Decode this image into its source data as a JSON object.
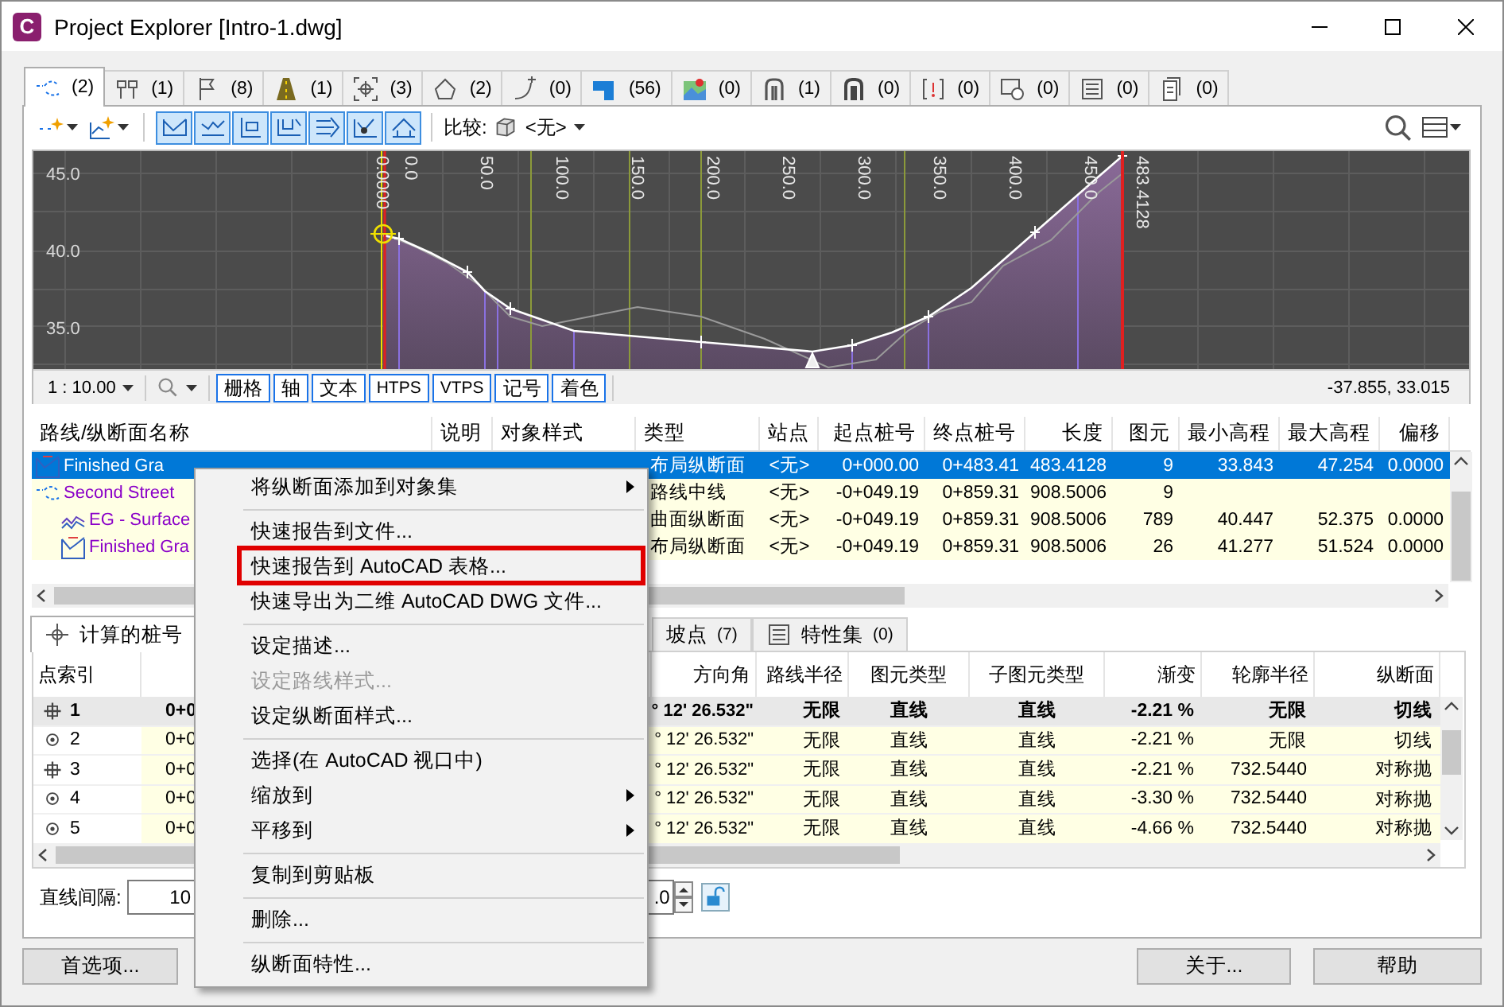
{
  "window": {
    "title": "Project Explorer [Intro-1.dwg]",
    "logo": "C"
  },
  "object_tabs": [
    {
      "count": "(2)",
      "selected": true
    },
    {
      "count": "(1)",
      "selected": false
    },
    {
      "count": "(8)",
      "selected": false
    },
    {
      "count": "(1)",
      "selected": false
    },
    {
      "count": "(3)",
      "selected": false
    },
    {
      "count": "(2)",
      "selected": false
    },
    {
      "count": "(0)",
      "selected": false
    },
    {
      "count": "(56)",
      "selected": false
    },
    {
      "count": "(0)",
      "selected": false
    },
    {
      "count": "(1)",
      "selected": false
    },
    {
      "count": "(0)",
      "selected": false
    },
    {
      "count": "(0)",
      "selected": false
    },
    {
      "count": "(0)",
      "selected": false
    },
    {
      "count": "(0)",
      "selected": false
    },
    {
      "count": "(0)",
      "selected": false
    }
  ],
  "toolbar": {
    "view_buttons": [
      {
        "on": true
      },
      {
        "on": true
      },
      {
        "on": true
      },
      {
        "on": true
      },
      {
        "on": true
      },
      {
        "on": true
      },
      {
        "on": true
      }
    ],
    "compare_label": "比较:",
    "compare_value": "<无>"
  },
  "profile_view": {
    "elevation_labels": [
      "45.0",
      "40.0",
      "35.0"
    ],
    "station_labels": [
      "0.0000",
      "0.0",
      "50.0",
      "100.0",
      "150.0",
      "200.0",
      "250.0",
      "300.0",
      "350.0",
      "400.0",
      "450.0",
      "483.4128"
    ],
    "scale": "1 : 10.00",
    "toggles": [
      {
        "label": "栅格",
        "on": true
      },
      {
        "label": "轴",
        "on": true
      },
      {
        "label": "文本",
        "on": true
      },
      {
        "label": "HTPS",
        "on": true
      },
      {
        "label": "VTPS",
        "on": true
      },
      {
        "label": "记号",
        "on": true
      },
      {
        "label": "着色",
        "on": true
      }
    ],
    "coordinates": "-37.855, 33.015"
  },
  "profile_list": {
    "columns": [
      "路线/纵断面名称",
      "说明",
      "对象样式",
      "类型",
      "站点",
      "起点桩号",
      "终点桩号",
      "长度",
      "图元",
      "最小高程",
      "最大高程",
      "偏移"
    ],
    "rows": [
      {
        "kind": "layout_profile",
        "selected": true,
        "cells": [
          "Finished Gra",
          null,
          null,
          "布局纵断面",
          "<无>",
          "0+000.00",
          "0+483.41",
          "483.4128",
          "9",
          "33.843",
          "47.254",
          "0.0000"
        ]
      },
      {
        "kind": "alignment",
        "selected": false,
        "cells": [
          "Second Street",
          null,
          null,
          "路线中线",
          "<无>",
          "-0+049.19",
          "0+859.31",
          "908.5006",
          "9",
          null,
          null,
          null
        ],
        "children": [
          {
            "kind": "surface_profile",
            "selected": false,
            "cells": [
              "EG - Surface",
              null,
              null,
              "曲面纵断面",
              "<无>",
              "-0+049.19",
              "0+859.31",
              "908.5006",
              "789",
              "40.447",
              "52.375",
              "0.0000"
            ]
          },
          {
            "kind": "layout_profile",
            "selected": false,
            "cells": [
              "Finished Gra",
              null,
              null,
              "布局纵断面",
              "<无>",
              "-0+049.19",
              "0+859.31",
              "908.5006",
              "26",
              "41.277",
              "51.524",
              "0.0000"
            ]
          }
        ]
      }
    ]
  },
  "detail_tabs": [
    {
      "label": "计算的桩号",
      "selected": true
    },
    {
      "label": "坡点",
      "count": "(7)",
      "selected": false
    },
    {
      "label": "特性集",
      "count": "(0)",
      "selected": false
    }
  ],
  "detail_table": {
    "columns": [
      "点索引",
      null,
      "方向角",
      "路线半径",
      "图元类型",
      "子图元类型",
      "渐变",
      "轮廓半径",
      "纵断面"
    ],
    "rows": [
      {
        "kind": "pvi",
        "selected": true,
        "cells": [
          "1",
          "0+0",
          "° 12' 26.532\"",
          "无限",
          "直线",
          "直线",
          "-2.21 %",
          "无限",
          "切线"
        ]
      },
      {
        "kind": "point",
        "selected": false,
        "cells": [
          "2",
          "0+0",
          "° 12' 26.532\"",
          "无限",
          "直线",
          "直线",
          "-2.21 %",
          "无限",
          "切线"
        ]
      },
      {
        "kind": "pvi",
        "selected": false,
        "cells": [
          "3",
          "0+0",
          "° 12' 26.532\"",
          "无限",
          "直线",
          "直线",
          "-2.21 %",
          "732.5440",
          "对称抛"
        ]
      },
      {
        "kind": "point",
        "selected": false,
        "cells": [
          "4",
          "0+0",
          "° 12' 26.532\"",
          "无限",
          "直线",
          "直线",
          "-3.30 %",
          "732.5440",
          "对称抛"
        ]
      },
      {
        "kind": "point",
        "selected": false,
        "cells": [
          "5",
          "0+0",
          "° 12' 26.532\"",
          "无限",
          "直线",
          "直线",
          "-4.66 %",
          "732.5440",
          "对称抛"
        ]
      }
    ]
  },
  "settings": {
    "line_interval_label": "直线间隔:",
    "line_interval_value": "10",
    "spinner_value": ".0"
  },
  "footer": {
    "left_buttons": [
      "首选项..."
    ],
    "right_buttons": [
      "关于...",
      "帮助"
    ]
  },
  "context_menu": {
    "items": [
      {
        "kind": "item",
        "label": "将纵断面添加到对象集",
        "submenu": true,
        "disabled": false,
        "highlighted": false
      },
      {
        "kind": "separator"
      },
      {
        "kind": "item",
        "label": "快速报告到文件...",
        "submenu": false,
        "disabled": false,
        "highlighted": false
      },
      {
        "kind": "item",
        "label": "快速报告到 AutoCAD 表格...",
        "submenu": false,
        "disabled": false,
        "highlighted": true
      },
      {
        "kind": "item",
        "label": "快速导出为二维 AutoCAD DWG 文件...",
        "submenu": false,
        "disabled": false,
        "highlighted": false
      },
      {
        "kind": "separator"
      },
      {
        "kind": "item",
        "label": "设定描述...",
        "submenu": false,
        "disabled": false,
        "highlighted": false
      },
      {
        "kind": "item",
        "label": "设定路线样式...",
        "submenu": false,
        "disabled": true,
        "highlighted": false
      },
      {
        "kind": "item",
        "label": "设定纵断面样式...",
        "submenu": false,
        "disabled": false,
        "highlighted": false
      },
      {
        "kind": "separator"
      },
      {
        "kind": "item",
        "label": "选择(在 AutoCAD 视口中)",
        "submenu": false,
        "disabled": false,
        "highlighted": false
      },
      {
        "kind": "item",
        "label": "缩放到",
        "submenu": true,
        "disabled": false,
        "highlighted": false
      },
      {
        "kind": "item",
        "label": "平移到",
        "submenu": true,
        "disabled": false,
        "highlighted": false
      },
      {
        "kind": "separator"
      },
      {
        "kind": "item",
        "label": "复制到剪贴板",
        "submenu": false,
        "disabled": false,
        "highlighted": false
      },
      {
        "kind": "separator"
      },
      {
        "kind": "item",
        "label": "删除...",
        "submenu": false,
        "disabled": false,
        "highlighted": false
      },
      {
        "kind": "separator"
      },
      {
        "kind": "item",
        "label": "纵断面特性...",
        "submenu": false,
        "disabled": false,
        "highlighted": false
      }
    ]
  }
}
